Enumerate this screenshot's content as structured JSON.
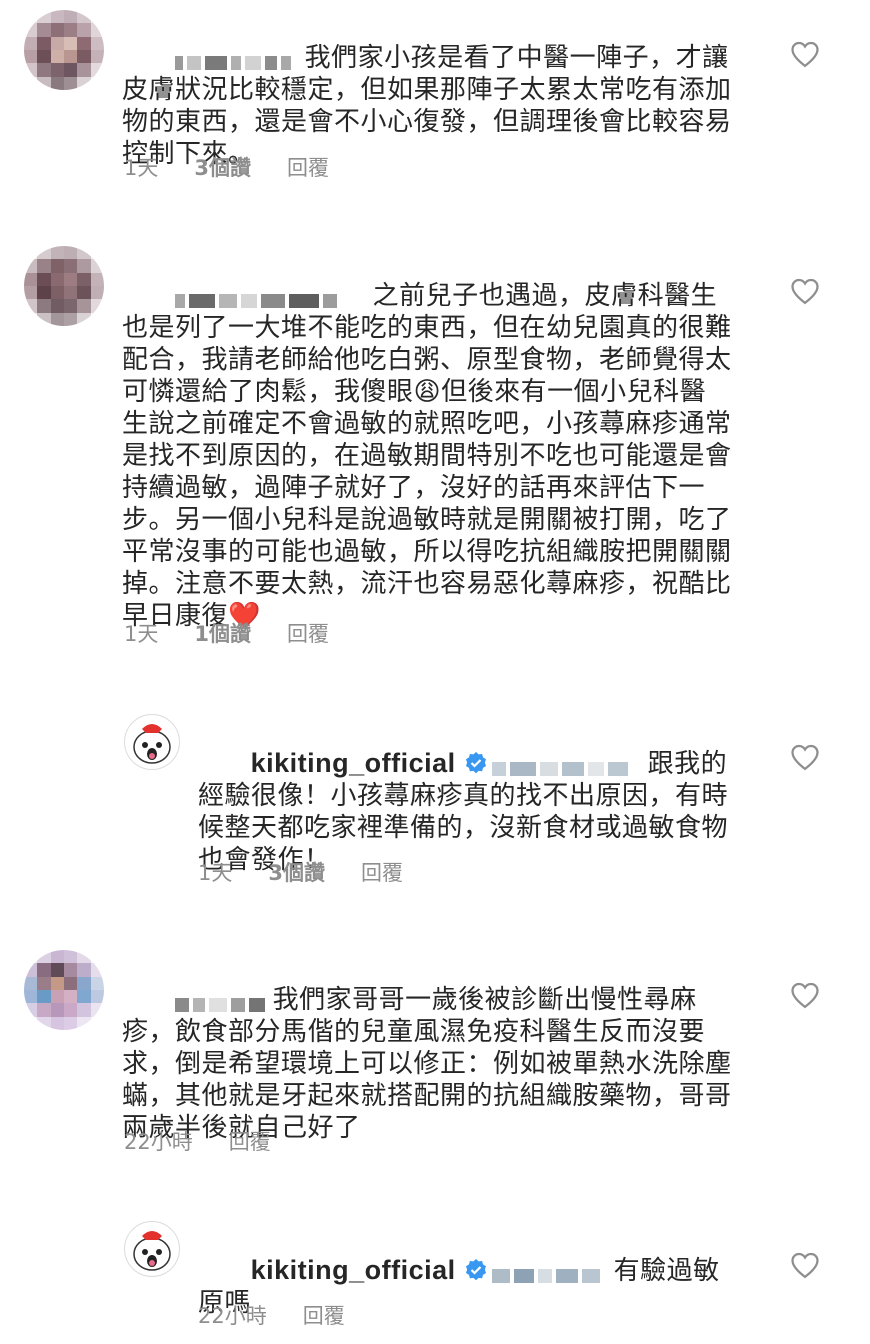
{
  "comments": [
    {
      "text": "我們家小孩是看了中醫一陣子，才讓皮膚狀況比較穩定，但如果那陣子太累太常吃有添加物的東西，還是會不小心復發，但調理後會比較容易控制下來。",
      "time": "1天",
      "likes": "3個讚",
      "reply": "回覆"
    },
    {
      "text": "之前兒子也遇過，皮膚科醫生也是列了一大堆不能吃的東西，但在幼兒園真的很難配合，我請老師給他吃白粥、原型食物，老師覺得太可憐還給了肉鬆，我傻眼😩但後來有一個小兒科醫生說之前確定不會過敏的就照吃吧，小孩蕁麻疹通常是找不到原因的，在過敏期間特別不吃也可能還是會持續過敏，過陣子就好了，沒好的話再來評估下一步。另一個小兒科是說過敏時就是開關被打開，吃了平常沒事的可能也過敏，所以得吃抗組織胺把開關關掉。注意不要太熱，流汗也容易惡化蕁麻疹，祝酷比早日康復❤️",
      "time": "1天",
      "likes": "1個讚",
      "reply": "回覆"
    },
    {
      "username": "kikiting_official",
      "text": "跟我的經驗很像！小孩蕁麻疹真的找不出原因，有時候整天都吃家裡準備的，沒新食材或過敏食物也會發作！",
      "time": "1天",
      "likes": "3個讚",
      "reply": "回覆"
    },
    {
      "text": "我們家哥哥一歲後被診斷出慢性尋麻疹，飲食部分馬偕的兒童風濕免疫科醫生反而沒要求，倒是希望環境上可以修正：例如被單熱水洗除塵蟎，其他就是牙起來就搭配開的抗組織胺藥物，哥哥兩歲半後就自己好了",
      "time": "22小時",
      "reply": "回覆"
    },
    {
      "username": "kikiting_official",
      "text": "有驗過敏原嗎",
      "time": "22小時",
      "reply": "回覆"
    }
  ],
  "colors": {
    "text": "#262626",
    "meta": "#8e8e8e",
    "verified": "#3897f0"
  },
  "icons": {
    "like": "heart-outline-icon",
    "verified": "verified-badge-icon"
  }
}
